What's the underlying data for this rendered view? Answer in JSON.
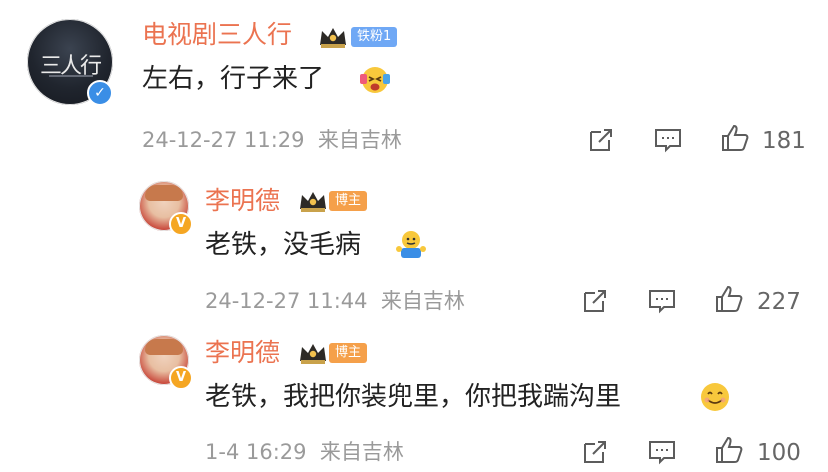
{
  "comments": [
    {
      "author": "电视剧三人行",
      "avatar_text": "三人行",
      "badge": "铁粉1",
      "text": "左右，行子来了",
      "time": "24-12-27 11:29",
      "source": "来自吉林",
      "likes": "181",
      "emoji": "excited-emoji"
    },
    {
      "author": "李明德",
      "badge": "博主",
      "text": "老铁，没毛病",
      "time": "24-12-27 11:44",
      "source": "来自吉林",
      "likes": "227",
      "emoji": "shrug-emoji"
    },
    {
      "author": "李明德",
      "badge": "博主",
      "text": "老铁，我把你装兜里，你把我踹沟里",
      "time": "1-4 16:29",
      "source": "来自吉林",
      "likes": "100",
      "emoji": "smile-emoji"
    }
  ],
  "colors": {
    "name": "#eb7350",
    "fan_badge": "#6fa8f5",
    "host_badge": "#f5a04a",
    "meta": "#9a9a9a",
    "verified_blue": "#3a8ee6",
    "verified_orange": "#f5a623"
  }
}
